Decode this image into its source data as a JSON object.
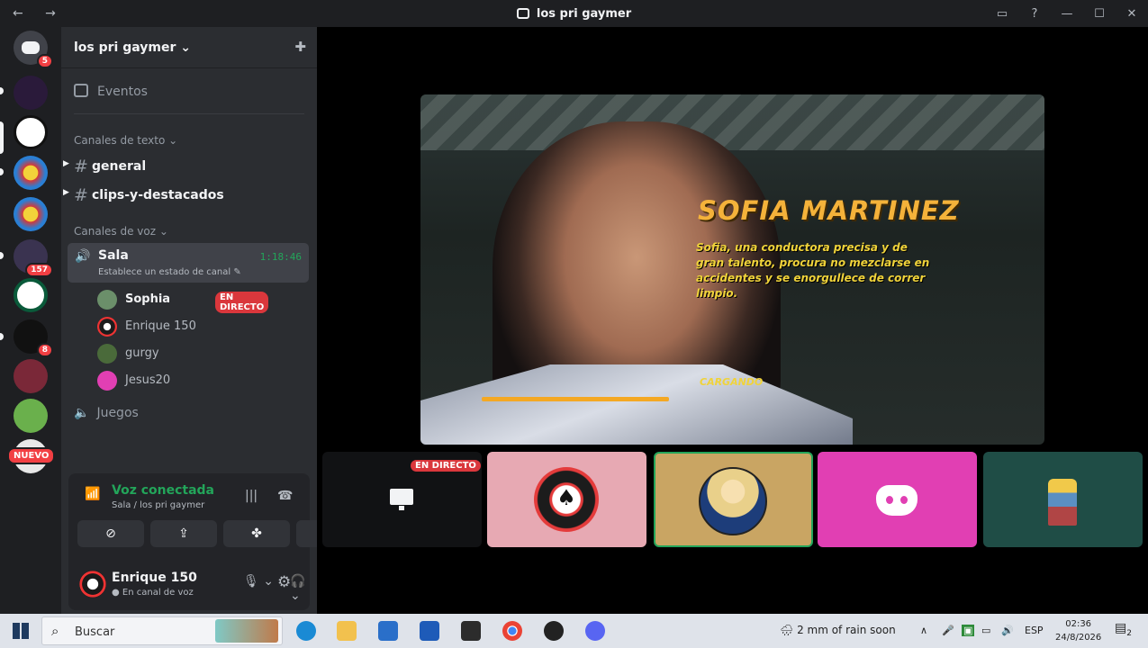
{
  "window": {
    "title": "los pri gaymer",
    "nav": "← →"
  },
  "servers": {
    "dm_badge": "5",
    "badges": [
      "157",
      "8"
    ],
    "new_label": "NUEVO"
  },
  "sidebar": {
    "guild_name": "los pri gaymer ⌄",
    "eventos": "Eventos",
    "text_category": "Canales de texto ⌄",
    "text_channels": [
      "general",
      "clips-y-destacados"
    ],
    "voice_category": "Canales de voz ⌄",
    "voice_channel": {
      "name": "Sala",
      "status": "Establece un estado de canal ✎",
      "timer": "1:18:46",
      "users": [
        {
          "name": "Sophia",
          "live": "EN DIRECTO",
          "avatar_color": "#6b8f6a"
        },
        {
          "name": "Enrique 150",
          "avatar_color": "#1c1c1c"
        },
        {
          "name": "gurgy",
          "avatar_color": "#4a6a3a"
        },
        {
          "name": "Jesus20",
          "avatar_color": "#e13fb3"
        }
      ]
    },
    "second_voice": "Juegos"
  },
  "voice_panel": {
    "title": "Voz conectada",
    "subtitle": "Sala / los pri gaymer",
    "user_name": "Enrique 150",
    "user_status": "● En canal de voz"
  },
  "stage": {
    "game_title": "SOFIA MARTINEZ",
    "game_desc": "Sofia, una conductora precisa y de gran talento, procura no mezclarse en accidentes y se enorgullece de correr limpio.",
    "loading": "CARGANDO",
    "loading_progress": 0.45,
    "tile_live": "EN DIRECTO"
  },
  "taskbar": {
    "search_placeholder": "Buscar",
    "weather": "2 mm of rain soon",
    "lang": "ESP",
    "time": "02:36",
    "date": "24/8/2026",
    "notifications": "2"
  },
  "colors": {
    "accent_green": "#23a55a",
    "live_red": "#da373c",
    "blurple": "#5865f2"
  }
}
